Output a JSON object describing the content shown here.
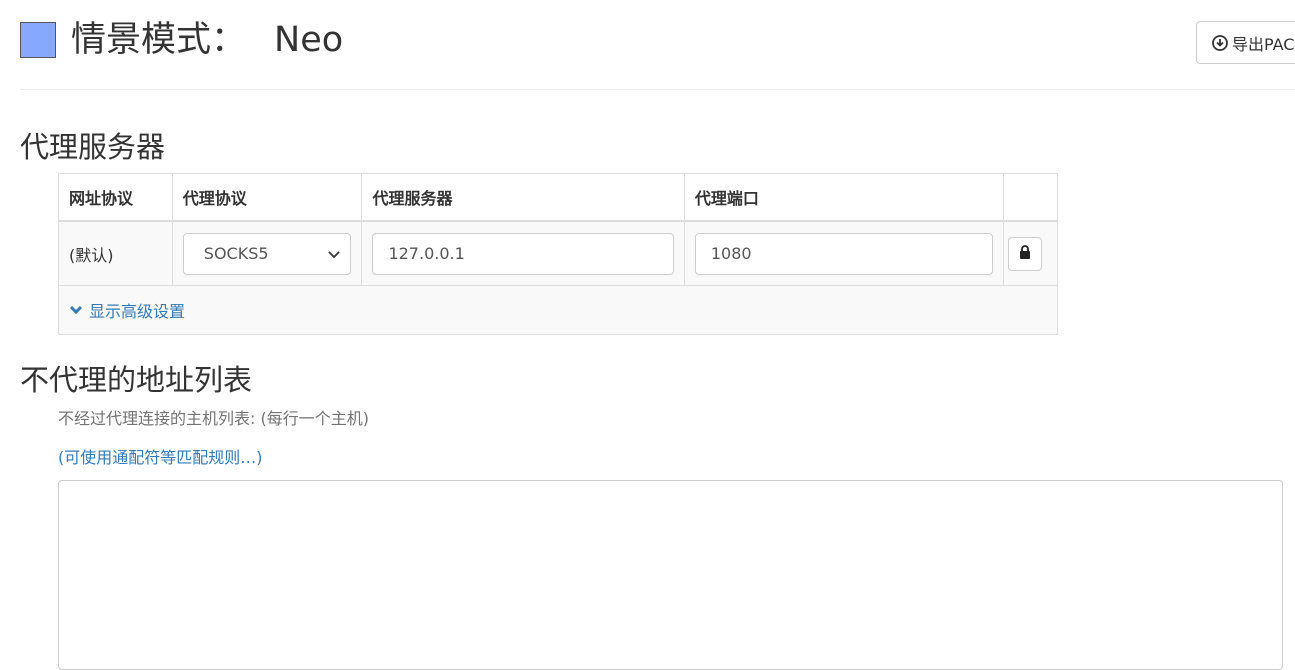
{
  "header": {
    "title_label": "情景模式：",
    "profile_name": "Neo",
    "profile_color": "#88a8ff",
    "export_button_label": "导出PAC",
    "export_icon": "download-circle-icon"
  },
  "proxy_section": {
    "title": "代理服务器",
    "columns": [
      "网址协议",
      "代理协议",
      "代理服务器",
      "代理端口",
      ""
    ],
    "row": {
      "scheme": "(默认)",
      "protocol": "SOCKS5",
      "server": "127.0.0.1",
      "port": "1080",
      "lock_icon": "lock-icon"
    },
    "advanced_label": "显示高级设置"
  },
  "bypass_section": {
    "title": "不代理的地址列表",
    "help": "不经过代理连接的主机列表: (每行一个主机)",
    "rules_link": "(可使用通配符等匹配规则…)",
    "value": ""
  },
  "colors": {
    "link": "#337ab7",
    "border": "#cccccc",
    "row_bg": "#f9f9f9"
  }
}
